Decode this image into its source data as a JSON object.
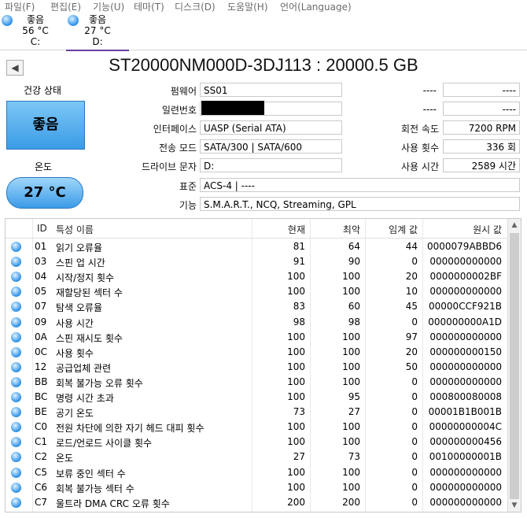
{
  "menu": [
    "파일(F)",
    "편집(E)",
    "기능(U)",
    "테마(T)",
    "디스크(D)",
    "도움말(H)",
    "언어(Language)"
  ],
  "disks": [
    {
      "status": "좋음",
      "temp": "56 °C",
      "drive": "C:"
    },
    {
      "status": "좋음",
      "temp": "27 °C",
      "drive": "D:"
    }
  ],
  "title": "ST20000NM000D-3DJ113 : 20000.5 GB",
  "health": {
    "label": "건강 상태",
    "value": "좋음"
  },
  "temperature": {
    "label": "온도",
    "value": "27 °C"
  },
  "info": {
    "firmware": {
      "label": "펌웨어",
      "value": "SS01"
    },
    "serial": {
      "label": "일련번호",
      "value": ""
    },
    "interface": {
      "label": "인터페이스",
      "value": "UASP (Serial ATA)"
    },
    "transfer": {
      "label": "전송 모드",
      "value": "SATA/300 | SATA/600"
    },
    "drive_letter": {
      "label": "드라이브 문자",
      "value": "D:"
    },
    "standard": {
      "label": "표준",
      "value": "ACS-4 | ----"
    },
    "features": {
      "label": "기능",
      "value": "S.M.A.R.T., NCQ, Streaming, GPL"
    }
  },
  "right_info": {
    "r1a": "----",
    "r1b": "----",
    "r2a": "----",
    "r2b": "----",
    "rotation": {
      "label": "회전 속도",
      "value": "7200 RPM"
    },
    "power_count": {
      "label": "사용 횟수",
      "value": "336 회"
    },
    "power_hours": {
      "label": "사용 시간",
      "value": "2589 시간"
    }
  },
  "table": {
    "headers": {
      "id": "ID",
      "name": "특성 이름",
      "current": "현재",
      "worst": "최악",
      "threshold": "임계 값",
      "raw": "원시 값"
    },
    "rows": [
      {
        "id": "01",
        "name": "읽기 오류율",
        "current": "81",
        "worst": "64",
        "threshold": "44",
        "raw": "0000079ABBD6"
      },
      {
        "id": "03",
        "name": "스핀 업 시간",
        "current": "91",
        "worst": "90",
        "threshold": "0",
        "raw": "000000000000"
      },
      {
        "id": "04",
        "name": "시작/정지 횟수",
        "current": "100",
        "worst": "100",
        "threshold": "20",
        "raw": "0000000002BF"
      },
      {
        "id": "05",
        "name": "재할당된 섹터 수",
        "current": "100",
        "worst": "100",
        "threshold": "10",
        "raw": "000000000000"
      },
      {
        "id": "07",
        "name": "탐색 오류율",
        "current": "83",
        "worst": "60",
        "threshold": "45",
        "raw": "00000CCF921B"
      },
      {
        "id": "09",
        "name": "사용 시간",
        "current": "98",
        "worst": "98",
        "threshold": "0",
        "raw": "000000000A1D"
      },
      {
        "id": "0A",
        "name": "스핀 재시도 횟수",
        "current": "100",
        "worst": "100",
        "threshold": "97",
        "raw": "000000000000"
      },
      {
        "id": "0C",
        "name": "사용 횟수",
        "current": "100",
        "worst": "100",
        "threshold": "20",
        "raw": "000000000150"
      },
      {
        "id": "12",
        "name": "공급업체 관련",
        "current": "100",
        "worst": "100",
        "threshold": "50",
        "raw": "000000000000"
      },
      {
        "id": "BB",
        "name": "회복 불가능 오류 횟수",
        "current": "100",
        "worst": "100",
        "threshold": "0",
        "raw": "000000000000"
      },
      {
        "id": "BC",
        "name": "명령 시간 초과",
        "current": "100",
        "worst": "95",
        "threshold": "0",
        "raw": "000800080008"
      },
      {
        "id": "BE",
        "name": "공기 온도",
        "current": "73",
        "worst": "27",
        "threshold": "0",
        "raw": "00001B1B001B"
      },
      {
        "id": "C0",
        "name": "전원 차단에 의한 자기 헤드 대피 횟수",
        "current": "100",
        "worst": "100",
        "threshold": "0",
        "raw": "00000000004C"
      },
      {
        "id": "C1",
        "name": "로드/언로드 사이클 횟수",
        "current": "100",
        "worst": "100",
        "threshold": "0",
        "raw": "000000000456"
      },
      {
        "id": "C2",
        "name": "온도",
        "current": "27",
        "worst": "73",
        "threshold": "0",
        "raw": "00100000001B"
      },
      {
        "id": "C5",
        "name": "보류 중인 섹터 수",
        "current": "100",
        "worst": "100",
        "threshold": "0",
        "raw": "000000000000"
      },
      {
        "id": "C6",
        "name": "회복 불가능 섹터 수",
        "current": "100",
        "worst": "100",
        "threshold": "0",
        "raw": "000000000000"
      },
      {
        "id": "C7",
        "name": "울트라 DMA CRC 오류 횟수",
        "current": "200",
        "worst": "200",
        "threshold": "0",
        "raw": "000000000000"
      }
    ]
  },
  "colors": {
    "accent": "#6a3ea1",
    "good": "#3a9be6"
  }
}
